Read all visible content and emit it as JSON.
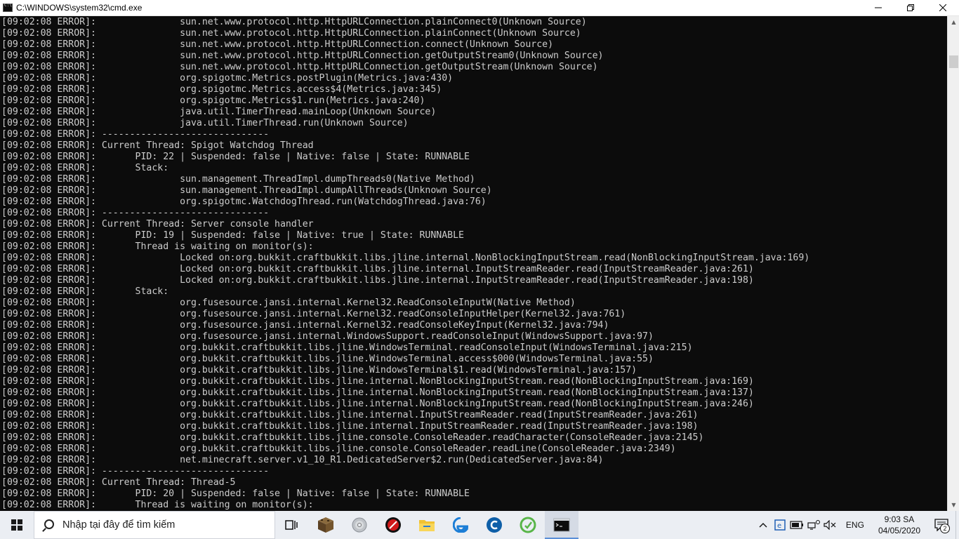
{
  "window": {
    "title": "C:\\WINDOWS\\system32\\cmd.exe",
    "icon": "cmd-icon"
  },
  "console": {
    "lines": [
      "[09:02:08 ERROR]:               sun.net.www.protocol.http.HttpURLConnection.plainConnect0(Unknown Source)",
      "[09:02:08 ERROR]:               sun.net.www.protocol.http.HttpURLConnection.plainConnect(Unknown Source)",
      "[09:02:08 ERROR]:               sun.net.www.protocol.http.HttpURLConnection.connect(Unknown Source)",
      "[09:02:08 ERROR]:               sun.net.www.protocol.http.HttpURLConnection.getOutputStream0(Unknown Source)",
      "[09:02:08 ERROR]:               sun.net.www.protocol.http.HttpURLConnection.getOutputStream(Unknown Source)",
      "[09:02:08 ERROR]:               org.spigotmc.Metrics.postPlugin(Metrics.java:430)",
      "[09:02:08 ERROR]:               org.spigotmc.Metrics.access$4(Metrics.java:345)",
      "[09:02:08 ERROR]:               org.spigotmc.Metrics$1.run(Metrics.java:240)",
      "[09:02:08 ERROR]:               java.util.TimerThread.mainLoop(Unknown Source)",
      "[09:02:08 ERROR]:               java.util.TimerThread.run(Unknown Source)",
      "[09:02:08 ERROR]: ------------------------------",
      "[09:02:08 ERROR]: Current Thread: Spigot Watchdog Thread",
      "[09:02:08 ERROR]:       PID: 22 | Suspended: false | Native: false | State: RUNNABLE",
      "[09:02:08 ERROR]:       Stack:",
      "[09:02:08 ERROR]:               sun.management.ThreadImpl.dumpThreads0(Native Method)",
      "[09:02:08 ERROR]:               sun.management.ThreadImpl.dumpAllThreads(Unknown Source)",
      "[09:02:08 ERROR]:               org.spigotmc.WatchdogThread.run(WatchdogThread.java:76)",
      "[09:02:08 ERROR]: ------------------------------",
      "[09:02:08 ERROR]: Current Thread: Server console handler",
      "[09:02:08 ERROR]:       PID: 19 | Suspended: false | Native: true | State: RUNNABLE",
      "[09:02:08 ERROR]:       Thread is waiting on monitor(s):",
      "[09:02:08 ERROR]:               Locked on:org.bukkit.craftbukkit.libs.jline.internal.NonBlockingInputStream.read(NonBlockingInputStream.java:169)",
      "[09:02:08 ERROR]:               Locked on:org.bukkit.craftbukkit.libs.jline.internal.InputStreamReader.read(InputStreamReader.java:261)",
      "[09:02:08 ERROR]:               Locked on:org.bukkit.craftbukkit.libs.jline.internal.InputStreamReader.read(InputStreamReader.java:198)",
      "[09:02:08 ERROR]:       Stack:",
      "[09:02:08 ERROR]:               org.fusesource.jansi.internal.Kernel32.ReadConsoleInputW(Native Method)",
      "[09:02:08 ERROR]:               org.fusesource.jansi.internal.Kernel32.readConsoleInputHelper(Kernel32.java:761)",
      "[09:02:08 ERROR]:               org.fusesource.jansi.internal.Kernel32.readConsoleKeyInput(Kernel32.java:794)",
      "[09:02:08 ERROR]:               org.fusesource.jansi.internal.WindowsSupport.readConsoleInput(WindowsSupport.java:97)",
      "[09:02:08 ERROR]:               org.bukkit.craftbukkit.libs.jline.WindowsTerminal.readConsoleInput(WindowsTerminal.java:215)",
      "[09:02:08 ERROR]:               org.bukkit.craftbukkit.libs.jline.WindowsTerminal.access$000(WindowsTerminal.java:55)",
      "[09:02:08 ERROR]:               org.bukkit.craftbukkit.libs.jline.WindowsTerminal$1.read(WindowsTerminal.java:157)",
      "[09:02:08 ERROR]:               org.bukkit.craftbukkit.libs.jline.internal.NonBlockingInputStream.read(NonBlockingInputStream.java:169)",
      "[09:02:08 ERROR]:               org.bukkit.craftbukkit.libs.jline.internal.NonBlockingInputStream.read(NonBlockingInputStream.java:137)",
      "[09:02:08 ERROR]:               org.bukkit.craftbukkit.libs.jline.internal.NonBlockingInputStream.read(NonBlockingInputStream.java:246)",
      "[09:02:08 ERROR]:               org.bukkit.craftbukkit.libs.jline.internal.InputStreamReader.read(InputStreamReader.java:261)",
      "[09:02:08 ERROR]:               org.bukkit.craftbukkit.libs.jline.internal.InputStreamReader.read(InputStreamReader.java:198)",
      "[09:02:08 ERROR]:               org.bukkit.craftbukkit.libs.jline.console.ConsoleReader.readCharacter(ConsoleReader.java:2145)",
      "[09:02:08 ERROR]:               org.bukkit.craftbukkit.libs.jline.console.ConsoleReader.readLine(ConsoleReader.java:2349)",
      "[09:02:08 ERROR]:               net.minecraft.server.v1_10_R1.DedicatedServer$2.run(DedicatedServer.java:84)",
      "[09:02:08 ERROR]: ------------------------------",
      "[09:02:08 ERROR]: Current Thread: Thread-5",
      "[09:02:08 ERROR]:       PID: 20 | Suspended: false | Native: false | State: RUNNABLE",
      "[09:02:08 ERROR]:       Thread is waiting on monitor(s):"
    ]
  },
  "taskbar": {
    "search_placeholder": "Nhập tại đây để tìm kiếm",
    "apps": [
      {
        "name": "task-view"
      },
      {
        "name": "minecraft"
      },
      {
        "name": "disc-app"
      },
      {
        "name": "red-app"
      },
      {
        "name": "file-explorer"
      },
      {
        "name": "edge"
      },
      {
        "name": "ccleaner"
      },
      {
        "name": "green-app"
      },
      {
        "name": "cmd"
      }
    ],
    "tray": {
      "language": "ENG",
      "time": "9:03 SA",
      "date": "04/05/2020",
      "notification_count": "2"
    }
  },
  "colors": {
    "console_bg": "#0c0c0c",
    "console_text": "#cccccc",
    "taskbar_bg": "#ebeef3"
  }
}
